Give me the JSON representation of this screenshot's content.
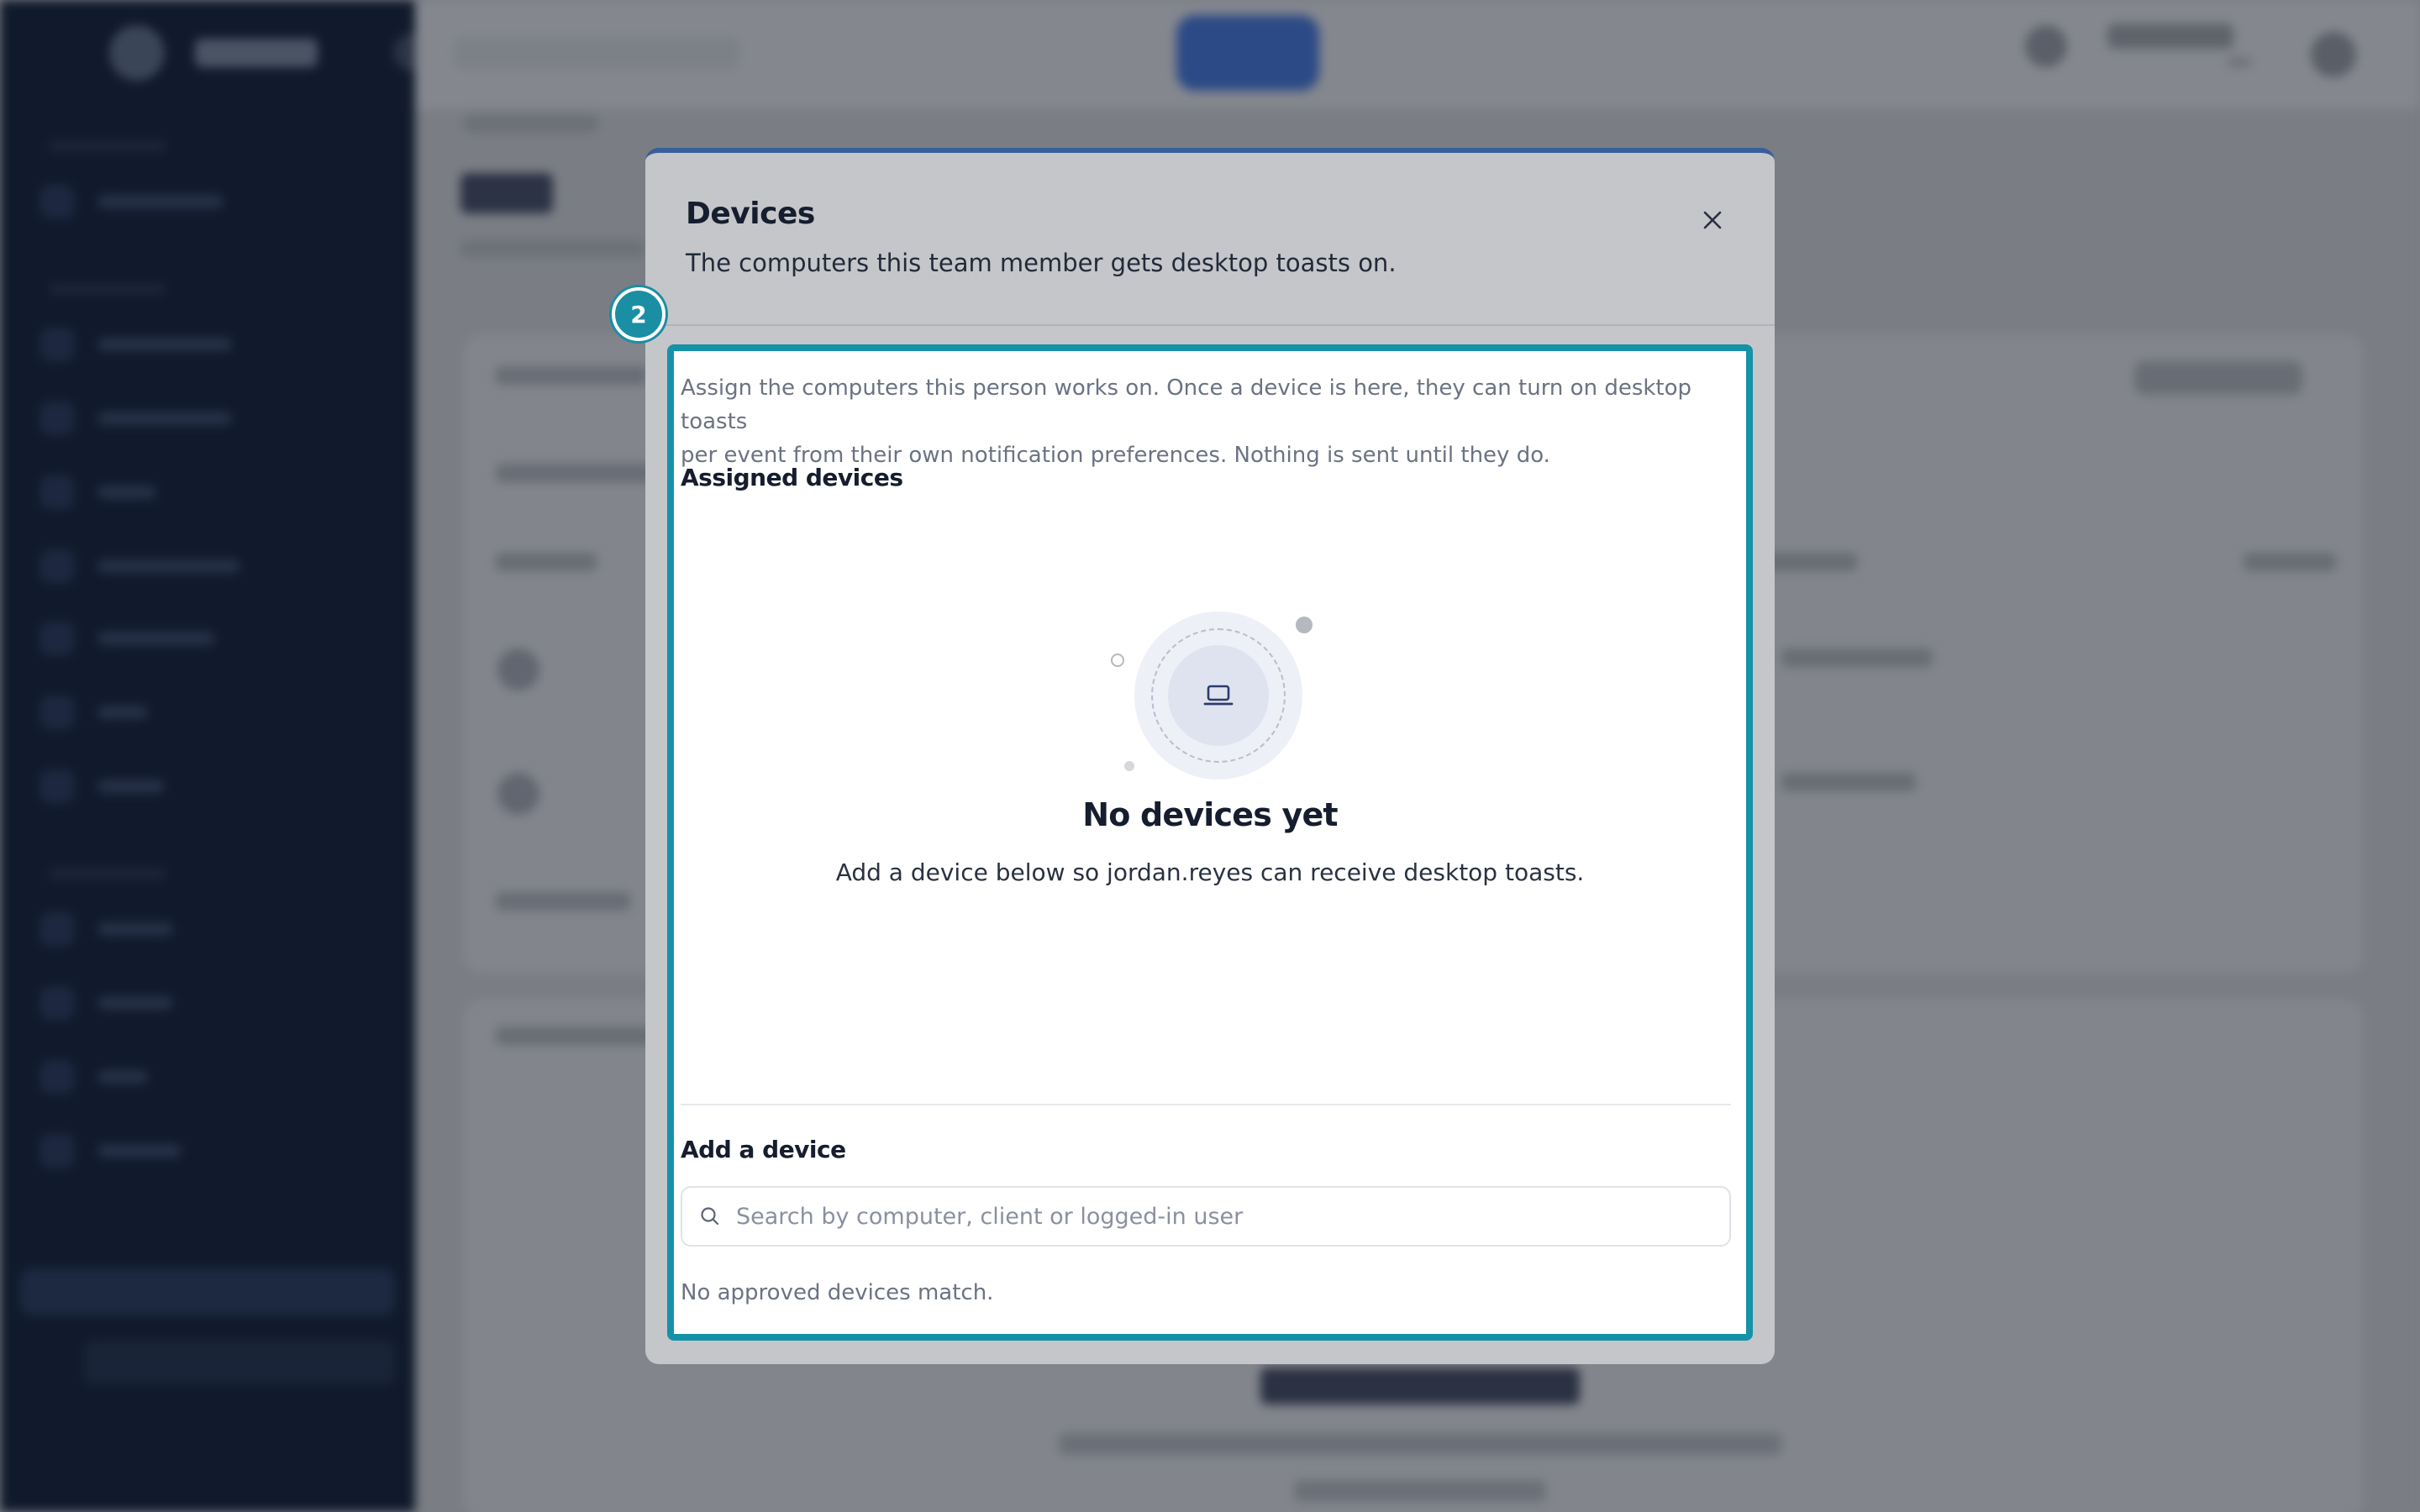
{
  "modal": {
    "title": "Devices",
    "subtitle": "The computers this team member gets desktop toasts on.",
    "close_icon": "close-icon"
  },
  "step_badge": "2",
  "panel": {
    "intro_line1": "Assign the computers this person works on. Once a device is here, they can turn on desktop toasts",
    "intro_line2": "per event from their own notification preferences. Nothing is sent until they do.",
    "assigned_heading": "Assigned devices",
    "empty_state": {
      "icon": "laptop-icon",
      "title": "No devices yet",
      "text": "Add a device below so jordan.reyes can receive desktop toasts."
    },
    "add_heading": "Add a device",
    "search": {
      "icon": "search-icon",
      "placeholder": "Search by computer, client or logged-in user",
      "value": ""
    },
    "no_match_text": "No approved devices match."
  },
  "colors": {
    "accent": "#1492a8",
    "modal_top_border": "#3a5e9c",
    "sidebar": "#101a2c"
  }
}
